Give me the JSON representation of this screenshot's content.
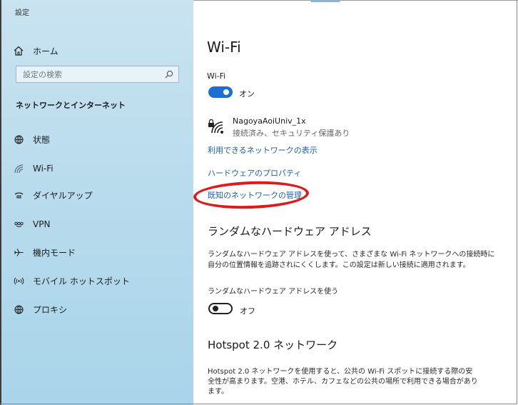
{
  "app": {
    "title": "設定"
  },
  "sidebar": {
    "home_label": "ホーム",
    "search_placeholder": "設定の検索",
    "section_title": "ネットワークとインターネット",
    "items": [
      {
        "label": "状態",
        "icon": "globe-icon"
      },
      {
        "label": "Wi-Fi",
        "icon": "wifi-icon",
        "active": true
      },
      {
        "label": "ダイヤルアップ",
        "icon": "dialup-icon"
      },
      {
        "label": "VPN",
        "icon": "vpn-icon"
      },
      {
        "label": "機内モード",
        "icon": "airplane-icon"
      },
      {
        "label": "モバイル ホットスポット",
        "icon": "hotspot-icon"
      },
      {
        "label": "プロキシ",
        "icon": "proxy-globe-icon"
      }
    ]
  },
  "main": {
    "title": "Wi-Fi",
    "wifi_toggle": {
      "label": "Wi-Fi",
      "state_text": "オン",
      "on": true
    },
    "network": {
      "name": "NagoyaAoiUniv_1x",
      "status": "接続済み、セキュリティ保護あり"
    },
    "links": {
      "show_networks": "利用できるネットワークの表示",
      "hardware_props": "ハードウェアのプロパティ",
      "manage_known": "既知のネットワークの管理"
    },
    "random_hw": {
      "heading": "ランダムなハードウェア アドレス",
      "desc_line1": "ランダムなハードウェア アドレスを使って、さまざまな Wi-Fi ネットワークへの接続時に",
      "desc_line2": "自分の位置情報を追跡されにくくします。この設定は新しい接続に適用されます。",
      "toggle_label": "ランダムなハードウェア アドレスを使う",
      "state_text": "オフ",
      "on": false
    },
    "hotspot": {
      "heading": "Hotspot 2.0 ネットワーク",
      "desc_line1": "Hotspot 2.0 ネットワークを使用すると、公共の Wi-Fi スポットに接続する際の安",
      "desc_line2": "全性が高まります。空港、ホテル、カフェなどの公共の場所で利用できる場合があり",
      "desc_line3": "ます。"
    }
  },
  "colors": {
    "accent": "#1f6fd2",
    "link": "#1c5fb3",
    "highlight_ellipse": "#e0191b",
    "sidebar": "#b9dced"
  }
}
